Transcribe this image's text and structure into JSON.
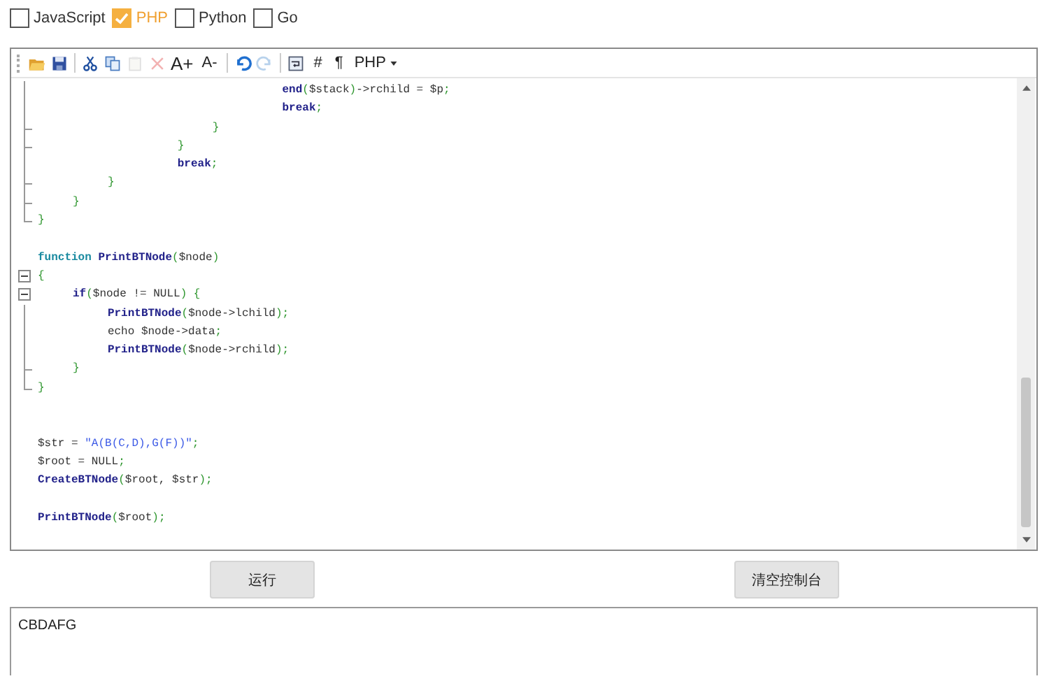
{
  "languages": [
    {
      "label": "JavaScript",
      "checked": false
    },
    {
      "label": "PHP",
      "checked": true
    },
    {
      "label": "Python",
      "checked": false
    },
    {
      "label": "Go",
      "checked": false
    }
  ],
  "toolbar": [
    {
      "kind": "icon",
      "disabled": false
    },
    {
      "kind": "icon",
      "disabled": false
    },
    {
      "kind": "separator"
    },
    {
      "kind": "icon",
      "disabled": false
    },
    {
      "kind": "icon",
      "disabled": false
    },
    {
      "kind": "icon",
      "disabled": true
    },
    {
      "kind": "icon",
      "disabled": true
    },
    {
      "kind": "large-text",
      "label": "A+"
    },
    {
      "kind": "text",
      "label": "A-"
    },
    {
      "kind": "separator"
    },
    {
      "kind": "icon",
      "disabled": false
    },
    {
      "kind": "icon",
      "disabled": true
    },
    {
      "kind": "separator"
    },
    {
      "kind": "icon",
      "disabled": false
    },
    {
      "kind": "text",
      "label": "#"
    },
    {
      "kind": "text",
      "label": "¶"
    },
    {
      "kind": "dropdown",
      "label": "PHP"
    }
  ],
  "code_lines": [
    {
      "kind": "line",
      "tokens": [
        {
          "kind": "name",
          "text": "\t\t\t\t\t\t\tend"
        },
        {
          "kind": "punct",
          "text": "("
        },
        {
          "kind": "plain",
          "text": "$stack"
        },
        {
          "kind": "punct",
          "text": ")"
        },
        {
          "kind": "plain",
          "text": "->rchild = $p"
        },
        {
          "kind": "punct",
          "text": ";"
        }
      ]
    },
    {
      "kind": "line",
      "tokens": [
        {
          "kind": "name",
          "text": "\t\t\t\t\t\t\tbreak"
        },
        {
          "kind": "punct",
          "text": ";"
        }
      ]
    },
    {
      "kind": "tick",
      "tokens": [
        {
          "kind": "punct",
          "text": "\t\t\t\t\t}"
        }
      ]
    },
    {
      "kind": "tick",
      "tokens": [
        {
          "kind": "punct",
          "text": "\t\t\t\t}"
        }
      ]
    },
    {
      "kind": "line",
      "tokens": [
        {
          "kind": "name",
          "text": "\t\t\t\tbreak"
        },
        {
          "kind": "punct",
          "text": ";"
        }
      ]
    },
    {
      "kind": "tick",
      "tokens": [
        {
          "kind": "punct",
          "text": "\t\t}"
        }
      ]
    },
    {
      "kind": "tick",
      "tokens": [
        {
          "kind": "punct",
          "text": "\t}"
        }
      ]
    },
    {
      "kind": "end",
      "tokens": [
        {
          "kind": "punct",
          "text": "}"
        }
      ]
    },
    {
      "kind": "blank"
    },
    {
      "kind": "plain",
      "tokens": [
        {
          "kind": "keyword",
          "text": "function"
        },
        {
          "kind": "name",
          "text": " PrintBTNode"
        },
        {
          "kind": "punct",
          "text": "("
        },
        {
          "kind": "plain",
          "text": "$node"
        },
        {
          "kind": "punct",
          "text": ")"
        }
      ]
    },
    {
      "kind": "start",
      "tokens": [
        {
          "kind": "punct",
          "text": "{"
        }
      ]
    },
    {
      "kind": "start",
      "tokens": [
        {
          "kind": "name",
          "text": "\tif"
        },
        {
          "kind": "punct",
          "text": "("
        },
        {
          "kind": "plain",
          "text": "$node != NULL"
        },
        {
          "kind": "punct",
          "text": ") {"
        }
      ]
    },
    {
      "kind": "line",
      "tokens": [
        {
          "kind": "name",
          "text": "\t\tPrintBTNode"
        },
        {
          "kind": "punct",
          "text": "("
        },
        {
          "kind": "plain",
          "text": "$node->lchild"
        },
        {
          "kind": "punct",
          "text": ");"
        }
      ]
    },
    {
      "kind": "line",
      "tokens": [
        {
          "kind": "plain",
          "text": "\t\techo $node->data"
        },
        {
          "kind": "punct",
          "text": ";"
        }
      ]
    },
    {
      "kind": "line",
      "tokens": [
        {
          "kind": "name",
          "text": "\t\tPrintBTNode"
        },
        {
          "kind": "punct",
          "text": "("
        },
        {
          "kind": "plain",
          "text": "$node->rchild"
        },
        {
          "kind": "punct",
          "text": ");"
        }
      ]
    },
    {
      "kind": "tick",
      "tokens": [
        {
          "kind": "punct",
          "text": "\t}"
        }
      ]
    },
    {
      "kind": "end",
      "tokens": [
        {
          "kind": "punct",
          "text": "}"
        }
      ]
    },
    {
      "kind": "blank"
    },
    {
      "kind": "blank"
    },
    {
      "kind": "plain",
      "tokens": [
        {
          "kind": "plain",
          "text": "$str = "
        },
        {
          "kind": "string",
          "text": "\"A(B(C,D),G(F))\""
        },
        {
          "kind": "punct",
          "text": ";"
        }
      ]
    },
    {
      "kind": "plain",
      "tokens": [
        {
          "kind": "plain",
          "text": "$root = NULL"
        },
        {
          "kind": "punct",
          "text": ";"
        }
      ]
    },
    {
      "kind": "plain",
      "tokens": [
        {
          "kind": "name",
          "text": "CreateBTNode"
        },
        {
          "kind": "punct",
          "text": "("
        },
        {
          "kind": "plain",
          "text": "$root, $str"
        },
        {
          "kind": "punct",
          "text": ");"
        }
      ]
    },
    {
      "kind": "blank"
    },
    {
      "kind": "plain",
      "tokens": [
        {
          "kind": "name",
          "text": "PrintBTNode"
        },
        {
          "kind": "punct",
          "text": "("
        },
        {
          "kind": "plain",
          "text": "$root"
        },
        {
          "kind": "punct",
          "text": ");"
        }
      ]
    }
  ],
  "buttons": [
    {
      "label": "运行"
    },
    {
      "label": "清空控制台"
    }
  ],
  "console": {
    "output": "CBDAFG"
  }
}
